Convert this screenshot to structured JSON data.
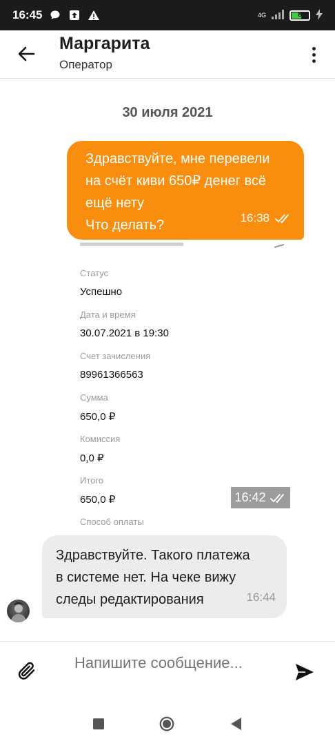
{
  "status_bar": {
    "time": "16:45",
    "network": "4G",
    "battery_level": "8",
    "icons": [
      "chat-icon",
      "upload-icon",
      "warning-icon",
      "signal-icon",
      "battery-icon",
      "charging-icon"
    ]
  },
  "header": {
    "contact_name": "Маргарита",
    "contact_role": "Оператор"
  },
  "chat": {
    "date_separator": "30 июля 2021",
    "outgoing": {
      "lines": [
        "Здравствуйте, мне перевели",
        "на счёт киви 650₽ денег всё",
        "ещё нету",
        "Что делать?"
      ],
      "time": "16:38"
    },
    "receipt_image": {
      "rows": [
        {
          "label": "Статус",
          "value": "Успешно"
        },
        {
          "label": "Дата и время",
          "value": "30.07.2021 в 19:30"
        },
        {
          "label": "Счет зачисления",
          "value": "89961366563"
        },
        {
          "label": "Сумма",
          "value": "650,0 ₽"
        },
        {
          "label": "Комиссия",
          "value": "0,0 ₽"
        },
        {
          "label": "Итого",
          "value": "650,0 ₽"
        }
      ],
      "last_label": "Способ оплаты",
      "time": "16:42"
    },
    "incoming": {
      "lines": [
        "Здравствуйте. Такого платежа",
        "в системе нет. На чеке вижу",
        "следы редактирования"
      ],
      "time": "16:44"
    }
  },
  "composer": {
    "placeholder": "Напишите сообщение..."
  },
  "colors": {
    "outgoing_bubble": "#f98d0e",
    "incoming_bubble": "#ececec",
    "status_bar": "#1b1b1b"
  }
}
